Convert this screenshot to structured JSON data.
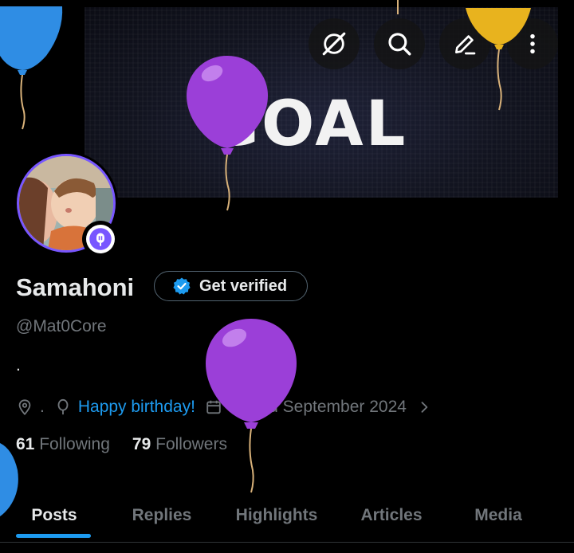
{
  "banner": {
    "text": "GOAL"
  },
  "header": {
    "icons": [
      "back-arrow-icon",
      "grok-icon",
      "search-icon",
      "edit-icon",
      "more-icon"
    ]
  },
  "profile": {
    "display_name": "Samahoni",
    "get_verified_label": "Get verified",
    "handle": "@Mat0Core",
    "bio": ".",
    "location": ".",
    "birthday_text": "Happy birthday!",
    "joined_text": "Joined September 2024",
    "following_count": "61",
    "following_label": "Following",
    "followers_count": "79",
    "followers_label": "Followers"
  },
  "tabs": {
    "items": [
      {
        "label": "Posts",
        "active": true
      },
      {
        "label": "Replies",
        "active": false
      },
      {
        "label": "Highlights",
        "active": false
      },
      {
        "label": "Articles",
        "active": false
      },
      {
        "label": "Media",
        "active": false
      }
    ]
  },
  "colors": {
    "background": "#000000",
    "text_primary": "#e7e9ea",
    "text_secondary": "#71767b",
    "accent_blue": "#1d9bf0",
    "avatar_ring": "#7856ff",
    "balloon_purple": "#9b3fd8",
    "balloon_blue": "#2f8de4",
    "balloon_yellow": "#e8b31e"
  }
}
